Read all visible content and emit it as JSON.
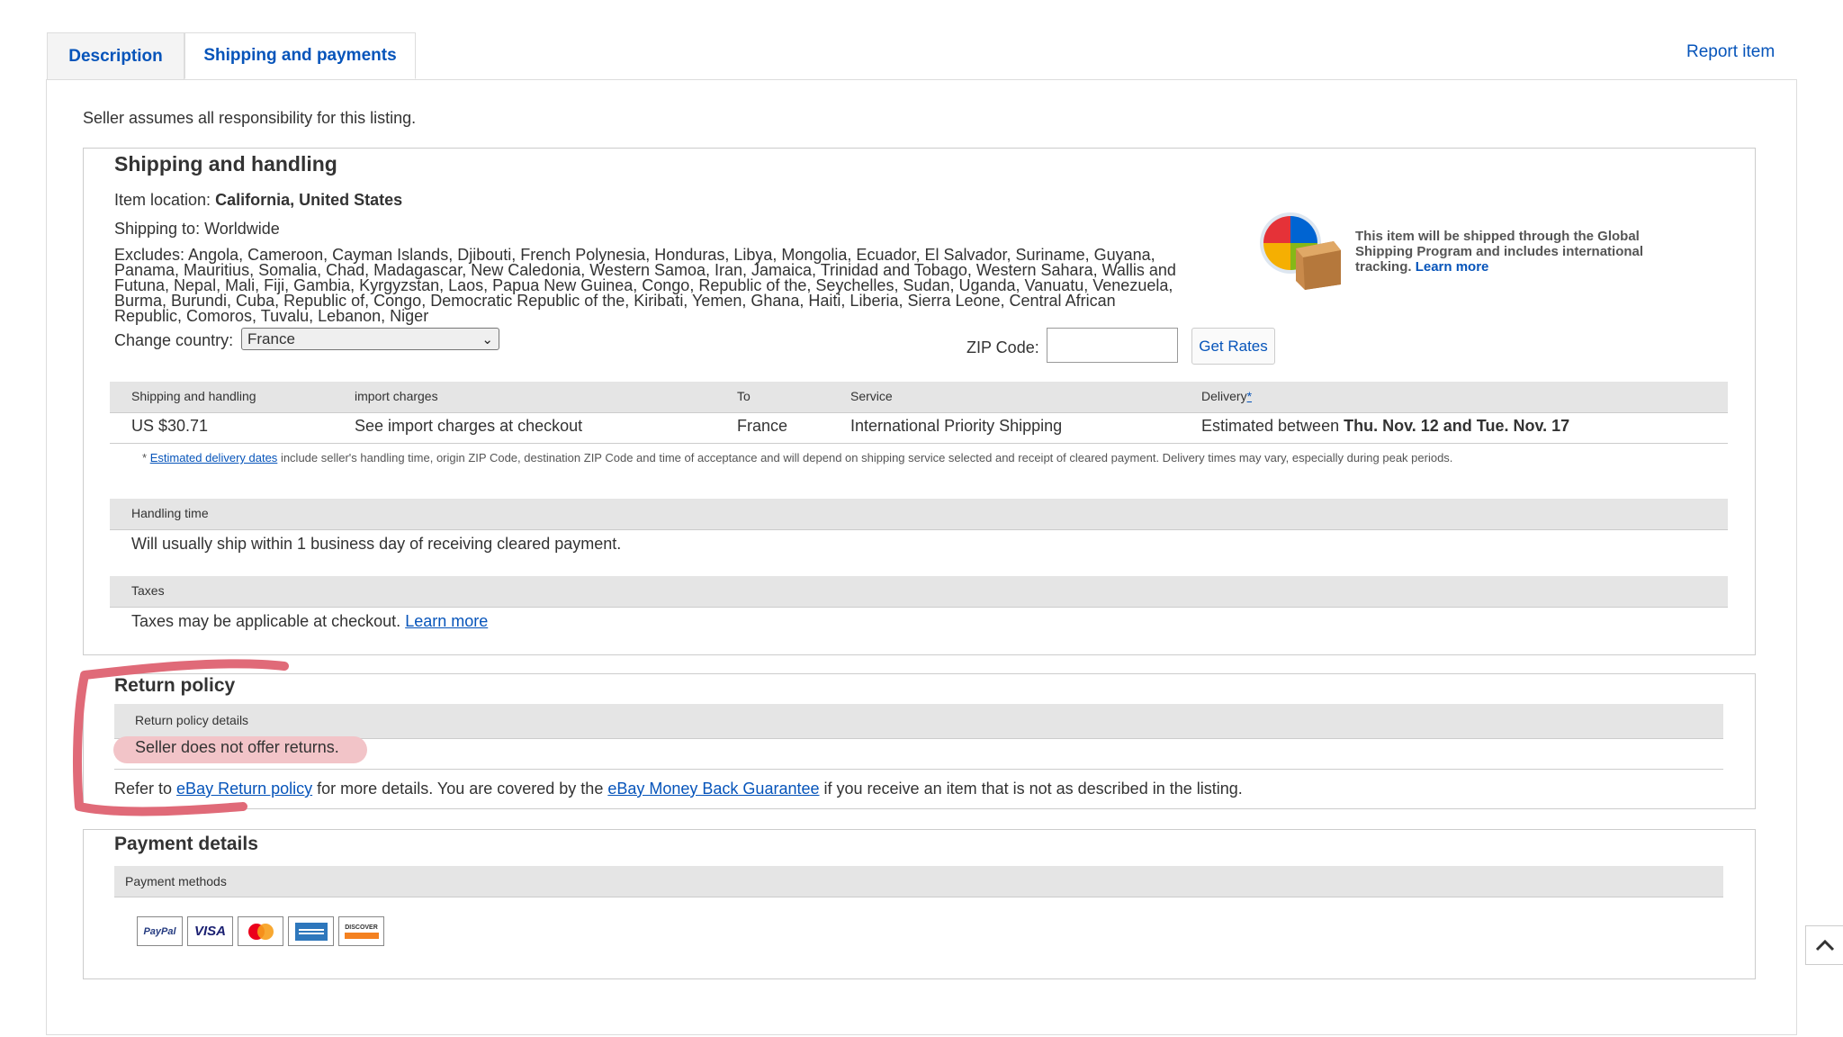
{
  "tabs": [
    {
      "label": "Description"
    },
    {
      "label": "Shipping and payments"
    }
  ],
  "report_item": "Report item",
  "seller_note": "Seller assumes all responsibility for this listing.",
  "shipping": {
    "title": "Shipping and handling",
    "item_location_label": "Item location:",
    "item_location": "California, United States",
    "shipping_to": "Shipping to: Worldwide",
    "excludes_lines": [
      "Excludes: Angola, Cameroon, Cayman Islands, Djibouti, French Polynesia, Honduras, Libya, Mongolia, Ecuador, El Salvador, Suriname, Guyana,",
      "Panama, Mauritius, Somalia, Chad, Madagascar, New Caledonia, Western Samoa, Iran, Jamaica, Trinidad and Tobago, Western Sahara, Wallis and",
      "Futuna, Nepal, Mali, Fiji, Gambia, Kyrgyzstan, Laos, Papua New Guinea, Congo, Republic of the, Seychelles, Sudan, Uganda, Vanuatu, Venezuela,",
      "Burma, Burundi, Cuba, Republic of, Congo, Democratic Republic of the, Kiribati, Yemen, Ghana, Haiti, Liberia, Sierra Leone, Central African",
      "Republic, Comoros, Tuvalu, Lebanon, Niger"
    ],
    "change_country_label": "Change country:",
    "country_selected": "France",
    "zip_label": "ZIP Code:",
    "zip_value": "",
    "get_rates": "Get Rates",
    "gsp_text_lines": [
      "This item will be shipped through the Global",
      "Shipping Program and includes international",
      "tracking."
    ],
    "gsp_learn_more": "Learn more",
    "table_headers": {
      "shipping": "Shipping and handling",
      "import": "import charges",
      "to": "To",
      "service": "Service",
      "delivery": "Delivery",
      "delivery_mark": "*"
    },
    "table_row": {
      "shipping": "US $30.71",
      "import": "See import charges at checkout",
      "to": "France",
      "service": "International Priority Shipping",
      "delivery_prefix": "Estimated between",
      "delivery_dates": "Thu. Nov. 12 and Tue. Nov. 17"
    },
    "footnote_star": "*",
    "footnote_link": "Estimated delivery dates",
    "footnote_text": "include seller's handling time, origin ZIP Code, destination ZIP Code and time of acceptance and will depend on shipping service selected and receipt of cleared payment. Delivery times may vary, especially during peak periods.",
    "handling_header": "Handling time",
    "handling_text": "Will usually ship within 1 business day of receiving cleared payment.",
    "taxes_header": "Taxes",
    "taxes_text": "Taxes may be applicable at checkout.",
    "taxes_link": "Learn more"
  },
  "returns": {
    "title": "Return policy",
    "details_header": "Return policy details",
    "details_text": "Seller does not offer returns.",
    "refer_prefix": "Refer to",
    "refer_link1": "eBay Return policy",
    "refer_mid": "for more details. You are covered by the",
    "refer_link2": "eBay Money Back Guarantee",
    "refer_suffix": "if you receive an item that is not as described in the listing."
  },
  "payment": {
    "title": "Payment details",
    "methods_header": "Payment methods",
    "methods": [
      {
        "label": "PayPal",
        "icon": "paypal-icon"
      },
      {
        "label": "VISA",
        "icon": "visa-icon"
      },
      {
        "label": "",
        "icon": "mastercard-icon"
      },
      {
        "label": "",
        "icon": "amex-icon"
      },
      {
        "label": "DISCOVER",
        "icon": "discover-icon"
      }
    ]
  },
  "colors": {
    "link": "#0654ba",
    "annotation": "#e06a78",
    "highlight": "#f2c4c8"
  }
}
